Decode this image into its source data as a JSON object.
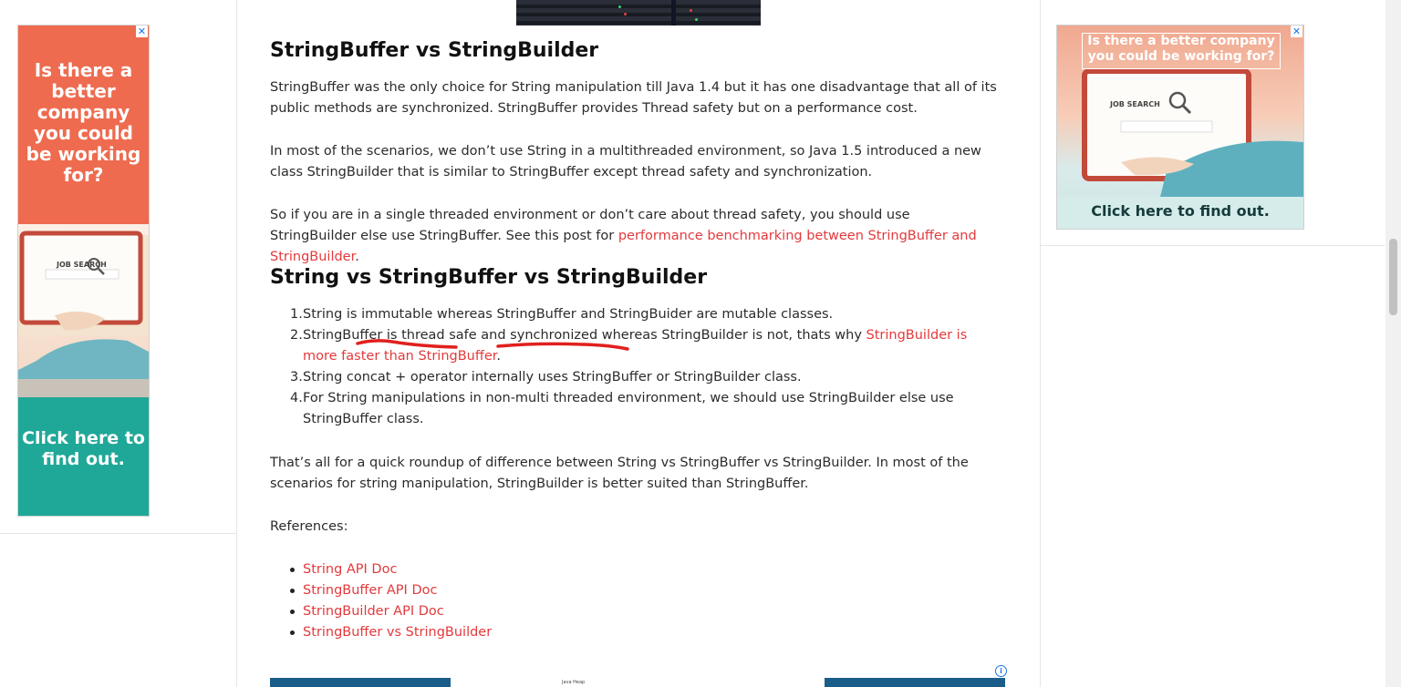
{
  "article": {
    "h_sb_vs_sbuilder": "StringBuffer vs StringBuilder",
    "p1": "StringBuffer was the only choice for String manipulation till Java 1.4 but it has one disadvantage that all of its public methods are synchronized. StringBuffer provides Thread safety but on a performance cost.",
    "p2": "In most of the scenarios, we don’t use String in a multithreaded environment, so Java 1.5 introduced a new class StringBuilder that is similar to StringBuffer except thread safety and synchronization.",
    "p3_text": "So if you are in a single threaded environment or don’t care about thread safety, you should use StringBuilder else use StringBuffer. See this post for ",
    "p3_link": "performance benchmarking between StringBuffer and StringBuilder",
    "p3_end": ".",
    "h_string_vs": "String vs StringBuffer vs StringBuilder",
    "list": [
      {
        "num": "1.",
        "text": "String is immutable whereas StringBuffer and StringBuider are mutable classes."
      },
      {
        "num": "2.",
        "text": "StringBuffer is thread safe and synchronized whereas StringBuilder is not, thats why ",
        "link": "StringBuilder is more faster than StringBuffer",
        "end": "."
      },
      {
        "num": "3.",
        "text": "String concat + operator internally uses StringBuffer or StringBuilder class."
      },
      {
        "num": "4.",
        "text": "For String manipulations in non-multi threaded environment, we should use StringBuilder else use StringBuffer class."
      }
    ],
    "p_summary": "That’s all for a quick roundup of difference between String vs StringBuffer vs StringBuilder. In most of the scenarios for string manipulation, StringBuilder is better suited than StringBuffer.",
    "references_label": "References:",
    "references": [
      "String API Doc",
      "StringBuffer API Doc",
      "StringBuilder API Doc",
      "StringBuffer vs StringBuilder"
    ]
  },
  "ads": {
    "left": {
      "headline": "Is there a better company you could be working for?",
      "cta": "Click here to find out.",
      "screen_text": "JOB SEARCH",
      "close": "✕"
    },
    "right": {
      "headline": "Is there a better company you could be working for?",
      "cta": "Click here to find out.",
      "screen_text": "JOB SEARCH",
      "close": "✕"
    },
    "adchoices": "i",
    "bottom_text": "Java Heap"
  },
  "colors": {
    "link": "#e4393c",
    "ad_orange": "#ee6b4f",
    "ad_teal": "#1fa898"
  }
}
